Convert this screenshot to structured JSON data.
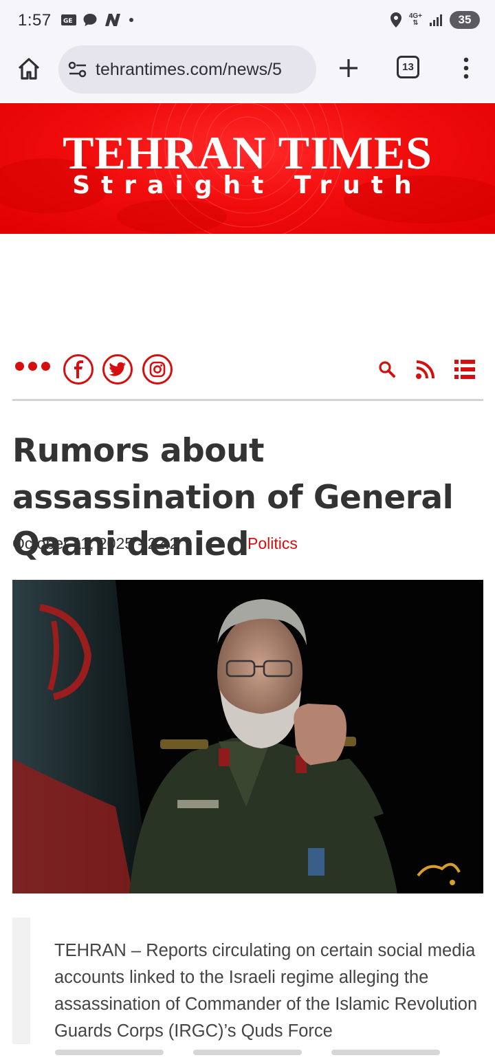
{
  "status_bar": {
    "time": "1:57",
    "battery": "35",
    "network": "4G+"
  },
  "browser": {
    "url": "tehrantimes.com/news/5",
    "tab_count": "13"
  },
  "banner": {
    "title": "TEHRAN TIMES",
    "subtitle": "Straight Truth"
  },
  "article": {
    "headline": "Rumors about assassination of General Qaani denied",
    "date": "October 11, 2025 - 22:2",
    "category": "Politics",
    "lead": "TEHRAN – Reports circulating on certain social media accounts linked to the Israeli regime alleging the assassination of Commander of the Islamic Revolution Guards Corps (IRGC)’s Quds Force"
  },
  "colors": {
    "brand_red": "#d50f0f",
    "banner_red": "#f20d0d",
    "headline_text": "#333333"
  },
  "icons": [
    "home-icon",
    "site-settings-icon",
    "new-tab-icon",
    "tab-switcher-icon",
    "overflow-menu-icon",
    "facebook-icon",
    "twitter-icon",
    "instagram-icon",
    "search-icon",
    "rss-icon",
    "list-menu-icon"
  ]
}
